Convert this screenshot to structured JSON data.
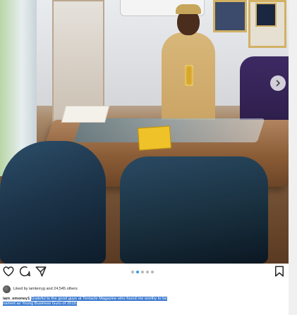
{
  "post": {
    "photo_alt": "",
    "carousel_index": 2,
    "carousel_total": 5
  },
  "icons": {
    "like": "heart-icon",
    "comment": "comment-icon",
    "share": "send-icon",
    "save": "bookmark-icon",
    "next": "chevron-right-icon"
  },
  "likes": {
    "text": "Liked by iamterryg and 24,545 others"
  },
  "caption": {
    "username": "iam_emoney1",
    "line1": "Grateful to the good guys at Tentacle Magazine who found me worthy to be",
    "line2": "named as Young Business Guru of 2019."
  },
  "colors": {
    "highlight": "#3b7ad0",
    "dot_active": "#3897f0",
    "dot_inactive": "#b8b8b8"
  }
}
